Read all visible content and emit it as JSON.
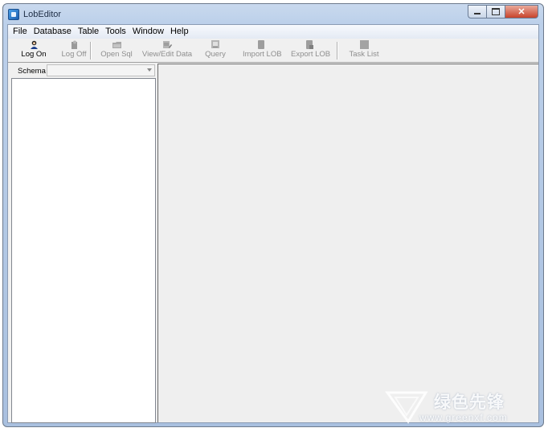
{
  "window": {
    "title": "LobEditor"
  },
  "menu": [
    "File",
    "Database",
    "Table",
    "Tools",
    "Window",
    "Help"
  ],
  "toolbar": [
    {
      "label": "Log On",
      "icon": "user-icon",
      "enabled": true
    },
    {
      "label": "Log Off",
      "icon": "logoff-icon",
      "enabled": false
    },
    {
      "label": "Open Sql",
      "icon": "folder-icon",
      "enabled": false
    },
    {
      "label": "View/Edit Data",
      "icon": "edit-data-icon",
      "enabled": false
    },
    {
      "label": "Query",
      "icon": "query-icon",
      "enabled": false
    },
    {
      "label": "Import LOB",
      "icon": "import-icon",
      "enabled": false
    },
    {
      "label": "Export LOB",
      "icon": "export-icon",
      "enabled": false
    },
    {
      "label": "Task List",
      "icon": "task-list-icon",
      "enabled": false
    }
  ],
  "schema": {
    "label": "Schema",
    "value": ""
  },
  "watermark": {
    "brand": "绿色先锋",
    "url": "www.greenxf.com"
  }
}
